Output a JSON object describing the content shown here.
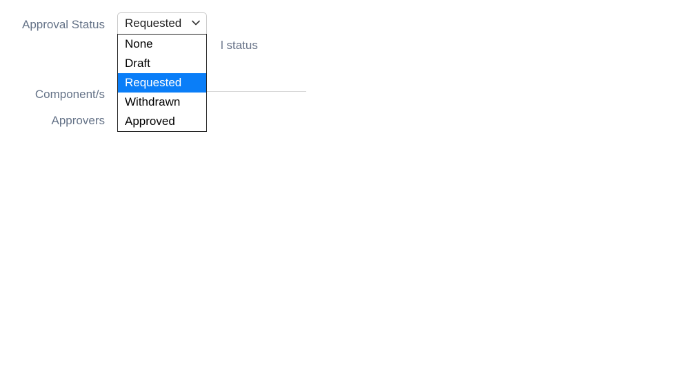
{
  "labels": {
    "approval_status": "Approval Status",
    "components": "Component/s",
    "approvers": "Approvers"
  },
  "approval_status_select": {
    "selected": "Requested",
    "options": [
      "None",
      "Draft",
      "Requested",
      "Withdrawn",
      "Approved"
    ],
    "selected_index": 2
  },
  "hint_fragment": "l status"
}
